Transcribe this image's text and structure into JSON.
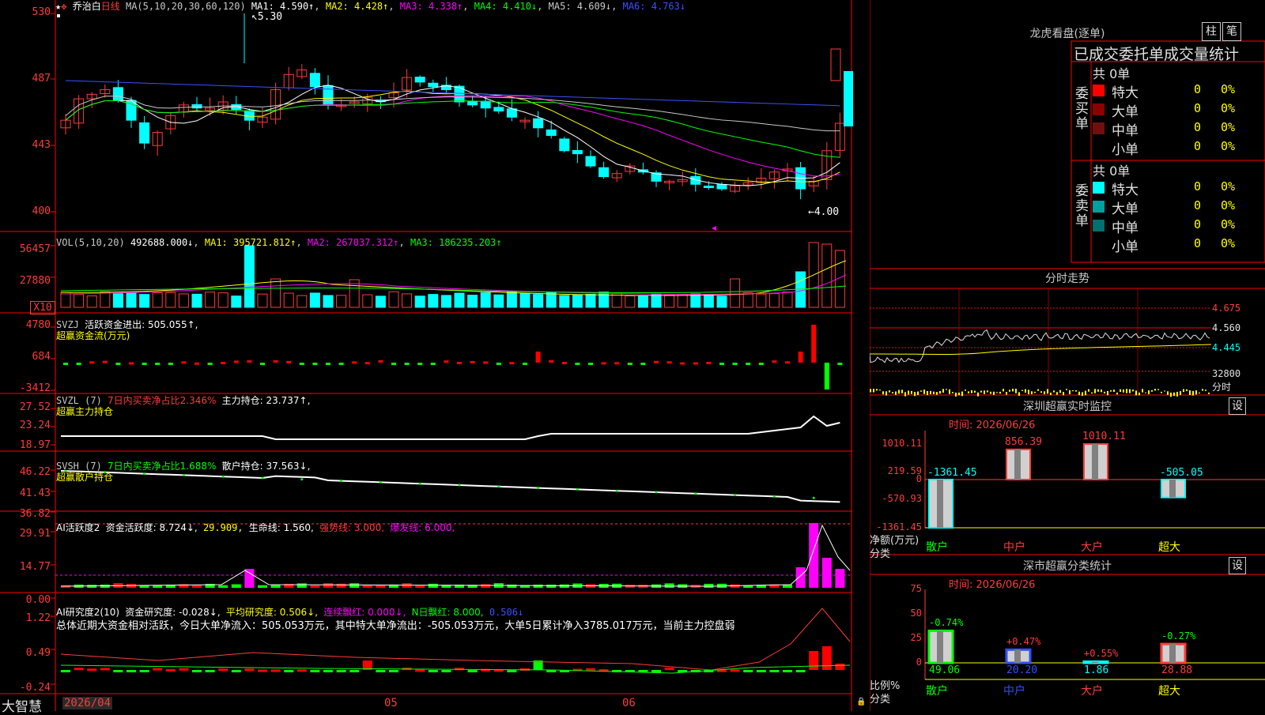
{
  "stock": {
    "name": "乔治白",
    "period": "日线"
  },
  "price_panel": {
    "header": {
      "ma_label": "MA(5,10,20,30,60,120)",
      "ma1": "MA1: 4.590↑",
      "ma2": "MA2: 4.428↑",
      "ma3": "MA3: 4.338↑",
      "ma4": "MA4: 4.410↓",
      "ma5": "MA5: 4.609↓",
      "ma6": "MA6: 4.763↓"
    },
    "yticks": [
      "530",
      "487",
      "443",
      "400"
    ],
    "high_annot": "5.30",
    "low_annot": "←4.00"
  },
  "vol_panel": {
    "header": {
      "name": "VOL(5,10,20)",
      "vol": "492688.000↓",
      "ma1": "MA1: 395721.812↑",
      "ma2": "MA2: 267037.312↑",
      "ma3": "MA3: 186235.203↑"
    },
    "yticks": [
      "56457",
      "27880"
    ],
    "unit": "X10"
  },
  "svzj_panel": {
    "header": {
      "name": "SVZJ",
      "active": "活跃资金进出: 505.055↑,"
    },
    "subtitle": "超赢资金流(万元)",
    "yticks": [
      "4780",
      "684",
      "-3412"
    ]
  },
  "svzl_panel": {
    "header": {
      "name": "SVZL (7)",
      "ratio": "7日内买卖净占比2.346%",
      "hold": "主力持仓: 23.737↑,"
    },
    "subtitle": "超赢主力持仓",
    "yticks": [
      "27.52",
      "23.24",
      "18.97"
    ]
  },
  "svsh_panel": {
    "header": {
      "name": "SVSH (7)",
      "ratio": "7日内买卖净占比1.688%",
      "hold": "散户持仓: 37.563↓,"
    },
    "subtitle": "超赢散户持仓",
    "yticks": [
      "46.22",
      "41.43",
      "36.82"
    ]
  },
  "ai_act_panel": {
    "header": {
      "name": "AI活跃度2",
      "act": "资金活跃度: 8.724↓,",
      "v2": "29.909,",
      "life": "生命线: 1.560,",
      "strong": "强势线: 3.000,",
      "burst": "爆发线: 6.000,"
    },
    "yticks": [
      "29.91",
      "14.77",
      "0.00"
    ]
  },
  "ai_res_panel": {
    "header": {
      "name": "AI研究度2(10)",
      "res": "资金研究度: -0.028↓,",
      "avg": "平均研究度: 0.506↓,",
      "cont": "连续飘红: 0.000↓,",
      "nday": "N日飘红: 8.000,",
      "v": "0.506↓"
    },
    "summary": "总体近期大资金相对活跃，今日大单净流入：505.053万元，其中特大单净流出：-505.053万元，大单5日累计净入3785.017万元，当前主力控盘弱",
    "yticks": [
      "1.22",
      "0.49",
      "-0.24"
    ]
  },
  "bottom_bar": {
    "brand": "大智慧",
    "date": "2026/04",
    "m05": "05",
    "m06": "06"
  },
  "dragon": {
    "title": "龙虎看盘(逐单)",
    "btn_bar": "柱",
    "btn_list": "笔",
    "stat_title": "已成交委托单成交量统计",
    "buy": {
      "label": "委买单",
      "total": "共 0单",
      "rows": [
        {
          "name": "特大",
          "color": "#ff0000",
          "v": "0",
          "p": "0%"
        },
        {
          "name": "大单",
          "color": "#8b0000",
          "v": "0",
          "p": "0%"
        },
        {
          "name": "中单",
          "color": "#6e1010",
          "v": "0",
          "p": "0%"
        },
        {
          "name": "小单",
          "color": "",
          "v": "0",
          "p": "0%"
        }
      ]
    },
    "sell": {
      "label": "委卖单",
      "total": "共 0单",
      "rows": [
        {
          "name": "特大",
          "color": "#00ffff",
          "v": "0",
          "p": "0%"
        },
        {
          "name": "大单",
          "color": "#00a0a0",
          "v": "0",
          "p": "0%"
        },
        {
          "name": "中单",
          "color": "#007070",
          "v": "0",
          "p": "0%"
        },
        {
          "name": "小单",
          "color": "",
          "v": "0",
          "p": "0%"
        }
      ]
    }
  },
  "intraday": {
    "title": "分时走势",
    "yticks": [
      "4.675",
      "4.560",
      "4.445",
      "32800",
      "分时"
    ]
  },
  "sz_monitor": {
    "title": "深圳超赢实时监控",
    "btn": "设",
    "time": "时间: 2026/06/26",
    "ylabels": [
      "1010.11",
      "219.59",
      "0",
      "-570.93",
      "-1361.45"
    ],
    "bars": [
      {
        "cat": "散户",
        "value": -1361.45,
        "label": "-1361.45"
      },
      {
        "cat": "中户",
        "value": 856.39,
        "label": "856.39"
      },
      {
        "cat": "大户",
        "value": 1010.11,
        "label": "1010.11"
      },
      {
        "cat": "超大",
        "value": -505.05,
        "label": "-505.05"
      }
    ],
    "ylabel1": "净额(万元)",
    "ylabel2": "分类"
  },
  "sz_class": {
    "title": "深市超赢分类统计",
    "btn": "设",
    "time": "时间: 2026/06/26",
    "ylabels": [
      "75",
      "50",
      "25",
      "0"
    ],
    "bars": [
      {
        "cat": "散户",
        "value": 49.06,
        "change": "-0.74%",
        "label": "49.06"
      },
      {
        "cat": "中户",
        "value": 20.2,
        "change": "+0.47%",
        "label": "20.20"
      },
      {
        "cat": "大户",
        "value": 1.86,
        "change": "+0.55%",
        "label": "1.86"
      },
      {
        "cat": "超大",
        "value": 28.88,
        "change": "-0.27%",
        "label": "28.88"
      }
    ],
    "ylabel1": "比例%",
    "ylabel2": "分类"
  },
  "colors": {
    "up": "#ff3b3b",
    "down": "#00ffff",
    "grid": "#ff0000"
  }
}
